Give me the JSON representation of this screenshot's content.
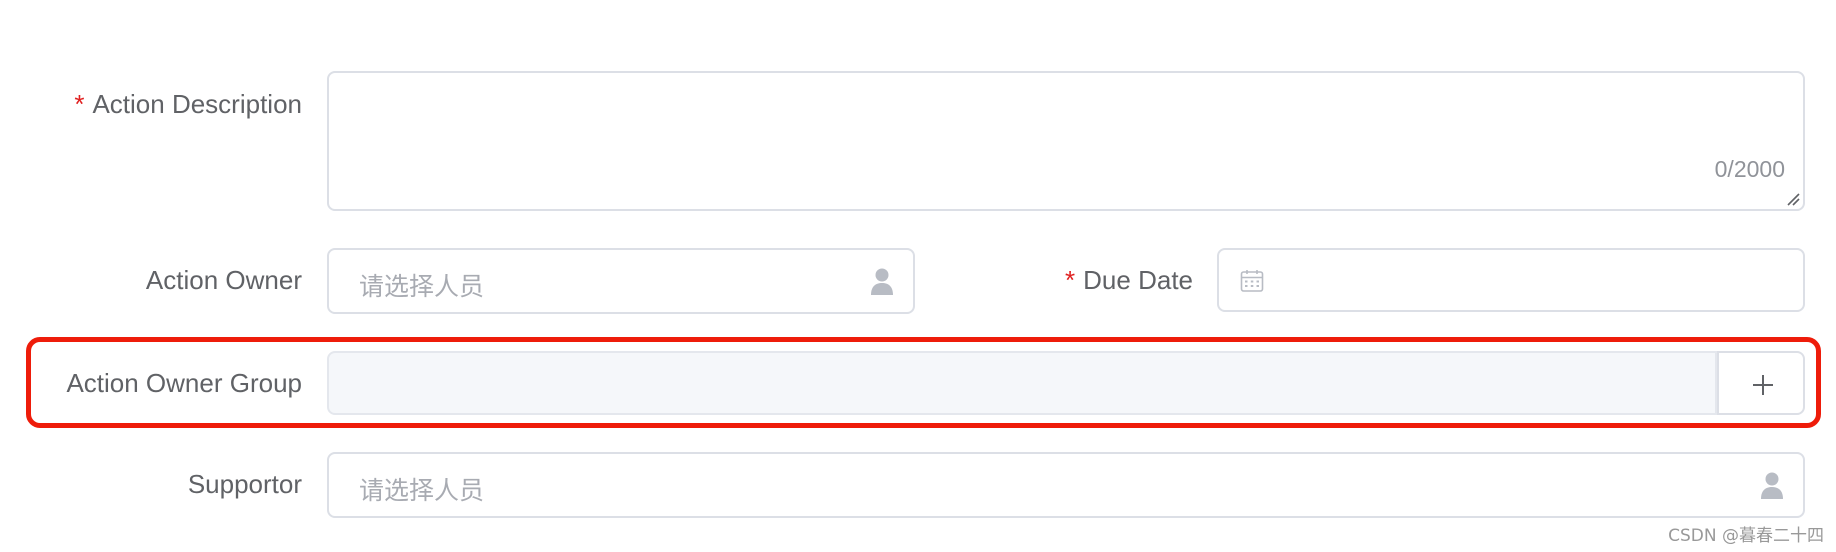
{
  "form": {
    "action_description": {
      "required_mark": "*",
      "label": "Action Description",
      "counter": "0/2000"
    },
    "action_owner": {
      "label": "Action Owner",
      "placeholder": "请选择人员"
    },
    "due_date": {
      "required_mark": "*",
      "label": "Due Date"
    },
    "action_owner_group": {
      "label": "Action Owner Group",
      "add_button_label": "+"
    },
    "supportor": {
      "label": "Supportor",
      "placeholder": "请选择人员"
    }
  },
  "watermark": "CSDN @暮春二十四",
  "colors": {
    "label": "#606266",
    "required": "#e02020",
    "border": "#dcdfe6",
    "placeholder": "#a8abb2",
    "disabled_bg": "#f5f7fa",
    "highlight": "#ee1c0a"
  },
  "icons": {
    "owner": "user-icon",
    "date": "calendar-icon",
    "add": "plus-icon",
    "supportor": "user-icon"
  }
}
